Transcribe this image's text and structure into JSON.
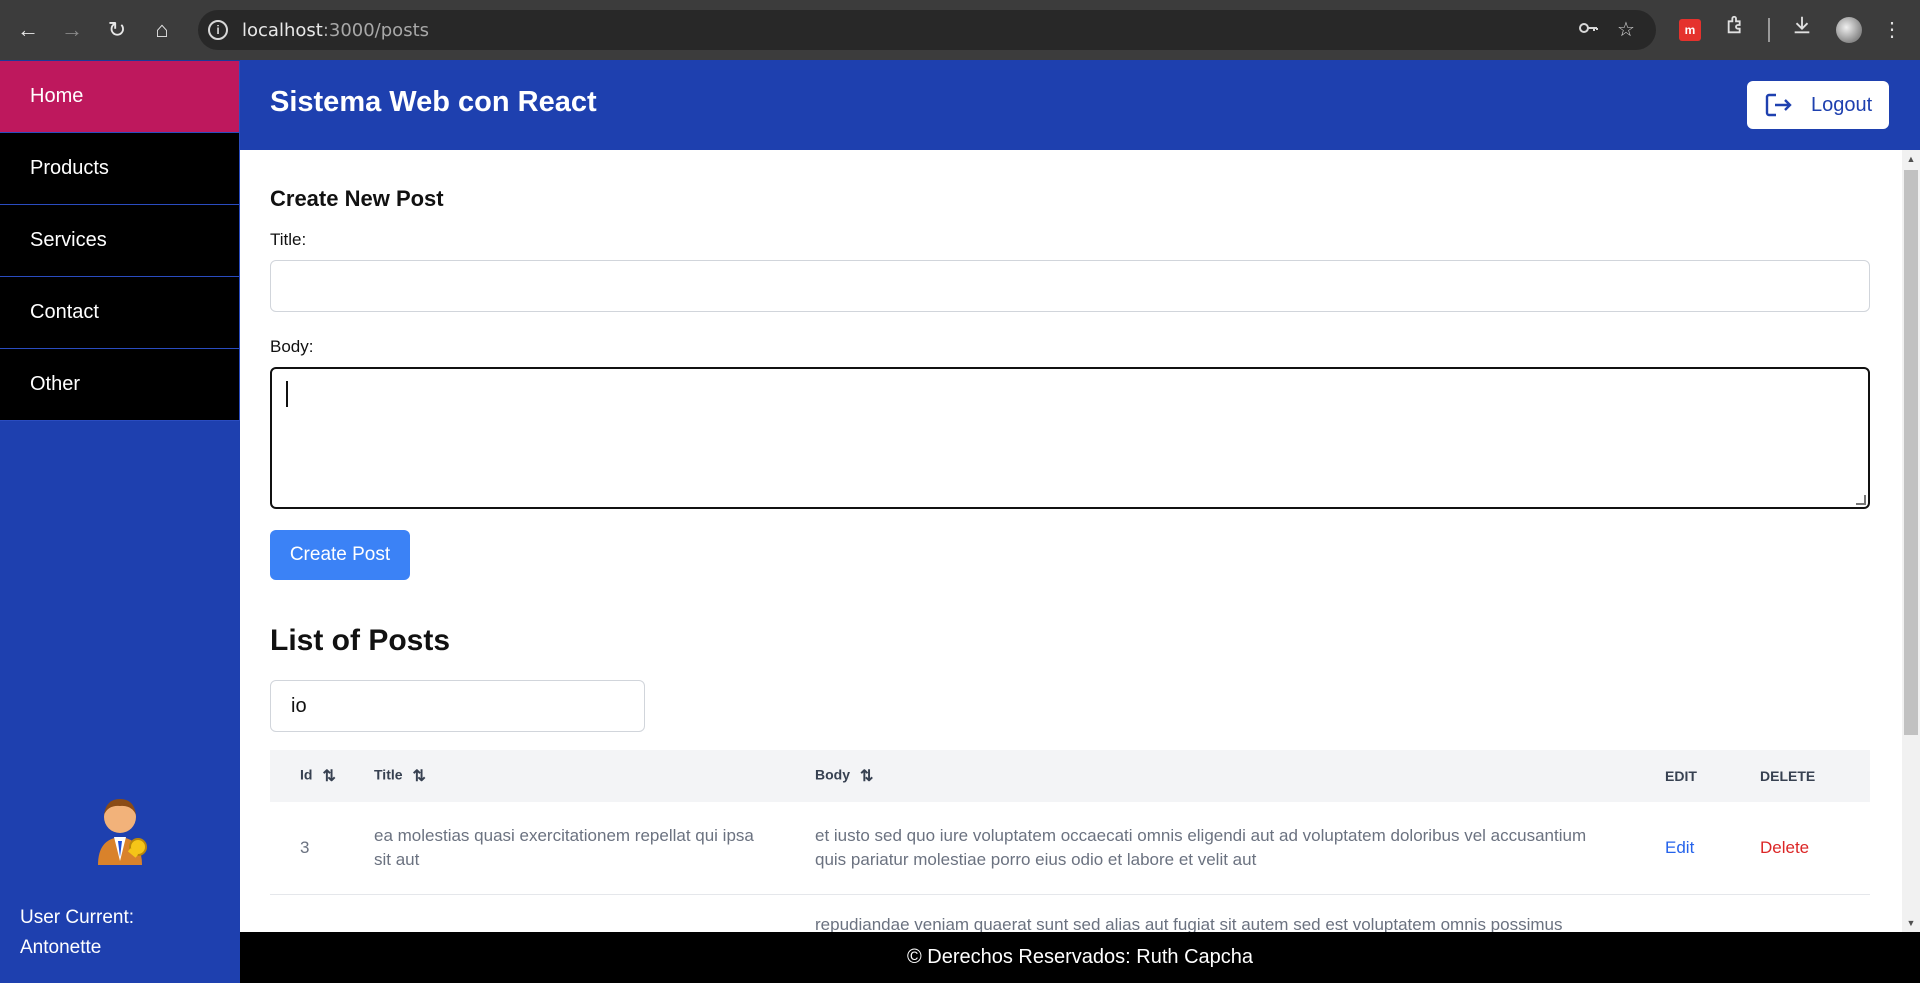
{
  "browser": {
    "url_host": "localhost",
    "url_path": ":3000/posts",
    "icons": [
      "back-icon",
      "forward-icon",
      "reload-icon",
      "home-icon",
      "site-info-icon",
      "password-key-icon",
      "bookmark-star-icon",
      "extension-icon",
      "downloads-icon",
      "menu-icon"
    ]
  },
  "sidebar": {
    "items": [
      {
        "label": "Home",
        "active": true
      },
      {
        "label": "Products"
      },
      {
        "label": "Services"
      },
      {
        "label": "Contact"
      },
      {
        "label": "Other"
      }
    ],
    "user_label": "User Current:",
    "user_name": "Antonette"
  },
  "header": {
    "brand": "Sistema Web con React",
    "logout_label": "Logout"
  },
  "form": {
    "heading": "Create New Post",
    "title_label": "Title:",
    "title_value": "",
    "body_label": "Body:",
    "body_value": "",
    "submit_label": "Create Post"
  },
  "posts": {
    "heading": "List of Posts",
    "search_value": "io",
    "columns": [
      "Id",
      "Title",
      "Body",
      "Edit",
      "Delete"
    ],
    "rows": [
      {
        "id": "3",
        "title": "ea molestias quasi exercitationem repellat qui ipsa sit aut",
        "body": "et iusto sed quo iure voluptatem occaecati omnis eligendi aut ad voluptatem doloribus vel accusantium quis pariatur molestiae porro eius odio et labore et velit aut",
        "edit": "Edit",
        "delete": "Delete"
      },
      {
        "id": "",
        "title": "",
        "body": "repudiandae veniam quaerat sunt sed alias aut fugiat sit autem sed est voluptatem omnis possimus",
        "edit": "",
        "delete": ""
      }
    ]
  },
  "footer": {
    "text": "© Derechos Reservados: Ruth Capcha"
  },
  "colors": {
    "primary": "#1e40af",
    "active_menu": "#be185d",
    "button": "#3b82f6"
  }
}
